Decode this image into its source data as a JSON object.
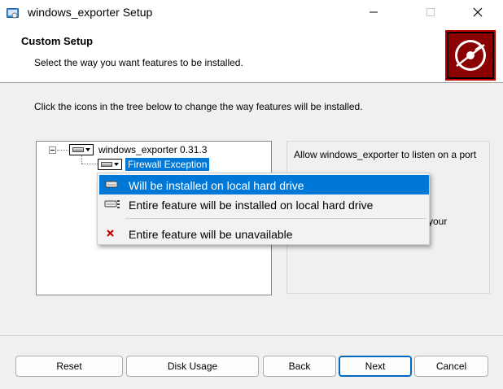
{
  "window": {
    "title": "windows_exporter Setup",
    "controls": {
      "minimize": "minimize-icon",
      "maximize": "maximize-icon",
      "close": "close-icon"
    }
  },
  "header": {
    "title": "Custom Setup",
    "subtitle": "Select the way you want features to be installed."
  },
  "instructions": "Click the icons in the tree below to change the way features will be installed.",
  "tree": {
    "root": {
      "label": "windows_exporter 0.31.3",
      "icon": "hard-drive-icon"
    },
    "children": [
      {
        "label": "Firewall Exception",
        "icon": "hard-drive-icon",
        "selected": true
      }
    ]
  },
  "description": {
    "line1": "Allow windows_exporter to listen on a port",
    "line2": "your"
  },
  "context_menu": {
    "items": [
      {
        "label": "Will be installed on local hard drive",
        "icon": "hard-drive-icon",
        "highlighted": true
      },
      {
        "label": "Entire feature will be installed on local hard drive",
        "icon": "hard-drive-all-icon",
        "highlighted": false
      },
      {
        "label": "Entire feature will be unavailable",
        "icon": "red-x-icon",
        "highlighted": false
      }
    ]
  },
  "buttons": {
    "reset": "Reset",
    "disk_usage": "Disk Usage",
    "back": "Back",
    "next": "Next",
    "cancel": "Cancel"
  },
  "colors": {
    "accent": "#0078d7",
    "banner": "#c00000",
    "unavailable_x": "#c00000"
  }
}
